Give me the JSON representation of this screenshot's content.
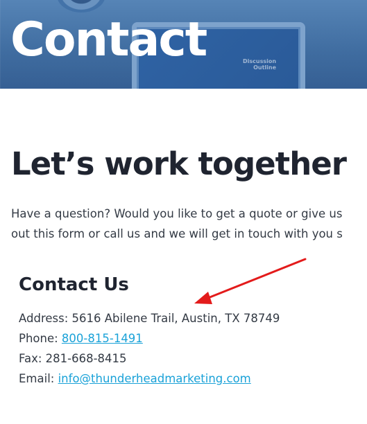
{
  "hero": {
    "title": "Contact",
    "screen_text_line1": "Discussion",
    "screen_text_line2": "Outline"
  },
  "main": {
    "heading": "Let’s work together",
    "intro_line1": "Have a question? Would you like to get a quote or give us",
    "intro_line2": "out this form or call us and we will get in touch with you s"
  },
  "contact": {
    "title": "Contact Us",
    "address_label": "Address: ",
    "address_value": "5616 Abilene Trail, Austin, TX 78749",
    "phone_label": "Phone: ",
    "phone_value": "800-815-1491",
    "fax_label": "Fax: ",
    "fax_value": "281-668-8415",
    "email_label": "Email: ",
    "email_value": "info@thunderheadmarketing.com"
  },
  "annotation": {
    "arrow_color": "#e31b1b",
    "icon": "red-arrow-icon"
  },
  "colors": {
    "link": "#1aa2d8",
    "hero_bg": "#3f6fa6",
    "text": "#1f2430"
  }
}
